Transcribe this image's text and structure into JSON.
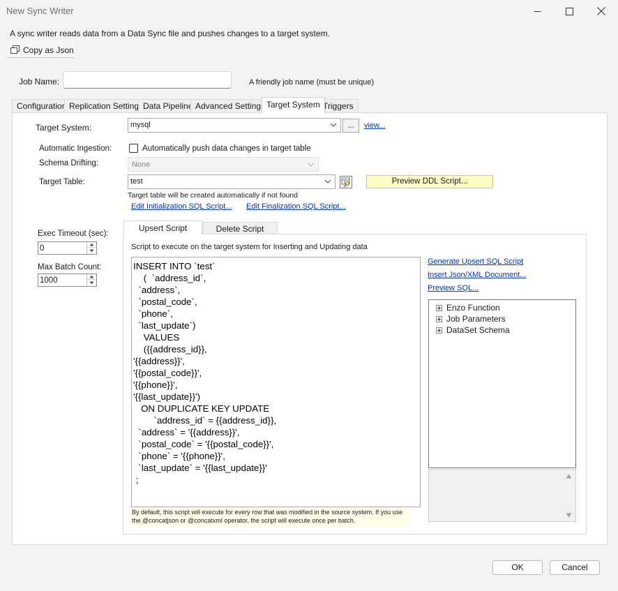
{
  "window": {
    "title": "New Sync Writer"
  },
  "description": "A sync writer reads data from a Data Sync file and pushes changes to a target system.",
  "toolbar": {
    "copy_json": "Copy as Json"
  },
  "job": {
    "label": "Job Name:",
    "value": "",
    "hint": "A friendly job name (must be unique)"
  },
  "tabs": [
    "Configuration",
    "Replication Settings",
    "Data Pipeline",
    "Advanced Settings",
    "Target System",
    "Triggers"
  ],
  "active_tab": "Target System",
  "target": {
    "system_label": "Target System:",
    "system_value": "mysql",
    "browse_label": "...",
    "view_link": "view...",
    "ingestion_label": "Automatic Ingestion:",
    "ingestion_checkbox": "Automatically push data changes in target table",
    "ingestion_checked": false,
    "drift_label": "Schema Drifting:",
    "drift_value": "None",
    "table_label": "Target Table:",
    "table_value": "test",
    "preview_ddl": "Preview DDL Script...",
    "table_note": "Target table will be created automatically if not found",
    "edit_init_link": "Edit Initialization SQL Script...",
    "edit_final_link": "Edit Finalization SQL Script..."
  },
  "exec": {
    "timeout_label": "Exec Timeout (sec):",
    "timeout_value": "0",
    "batch_label": "Max Batch Count:",
    "batch_value": "1000"
  },
  "script_tabs": [
    "Upsert Script",
    "Delete Script"
  ],
  "active_script_tab": "Upsert Script",
  "script": {
    "caption": "Script to execute on the target system for Inserting and Updating data",
    "text": "INSERT INTO `test`\n    (  `address_id`,\n  `address`,\n  `postal_code`,\n  `phone`,\n  `last_update`)\n    VALUES\n    ({{address_id}},\n'{{address}}',\n'{{postal_code}}',\n'{{phone}}',\n'{{last_update}}')\n   ON DUPLICATE KEY UPDATE\n        `address_id` = {{address_id}},\n  `address` = '{{address}}',\n  `postal_code` = '{{postal_code}}',\n  `phone` = '{{phone}}',\n  `last_update` = '{{last_update}}'\n ;",
    "note": "By default, this script will execute for every row that was modified in the source system.  If you use the @concatjson or @concatxml operator, the script will execute once per batch."
  },
  "side_links": {
    "generate": "Generate Upsert SQL Script",
    "insert_json": "Insert Json/XML Document...",
    "preview_sql": "Preview SQL..."
  },
  "tree": [
    "Enzo Function",
    "Job Parameters",
    "DataSet Schema"
  ],
  "buttons": {
    "ok": "OK",
    "cancel": "Cancel"
  }
}
